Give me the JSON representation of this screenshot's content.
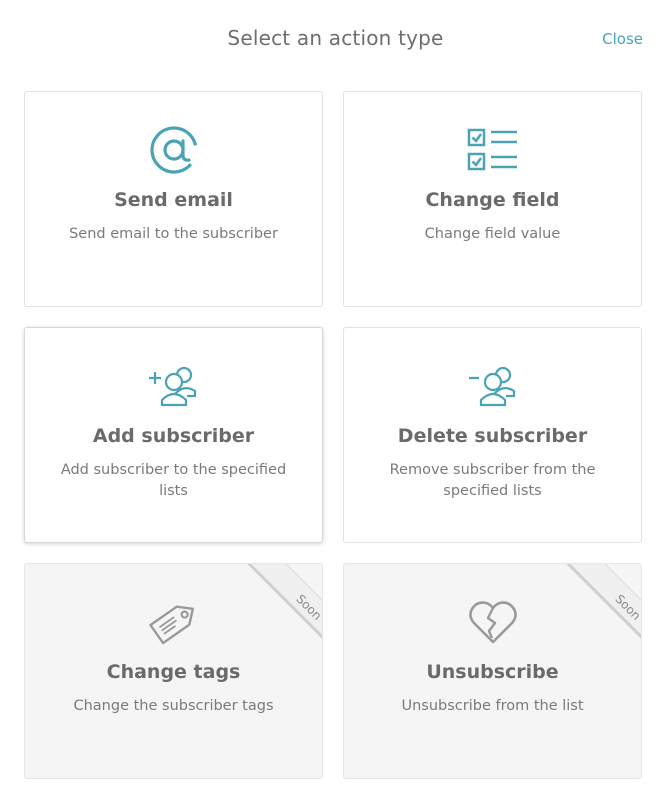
{
  "header": {
    "title": "Select an action type",
    "close_label": "Close"
  },
  "colors": {
    "accent": "#4aa3b5",
    "icon_gray": "#9a9a9a",
    "title_text": "#6a6a6a"
  },
  "cards": [
    {
      "name": "Send email",
      "description": "Send email to the subscriber",
      "icon": "at-icon",
      "soon": false
    },
    {
      "name": "Change field",
      "description": "Change field value",
      "icon": "checklist-icon",
      "soon": false
    },
    {
      "name": "Add subscriber",
      "description": "Add subscriber to the specified lists",
      "icon": "add-users-icon",
      "soon": false
    },
    {
      "name": "Delete subscriber",
      "description": "Remove subscriber from the specified lists",
      "icon": "remove-users-icon",
      "soon": false
    },
    {
      "name": "Change tags",
      "description": "Change the subscriber tags",
      "icon": "tag-icon",
      "soon": true,
      "badge": "Soon"
    },
    {
      "name": "Unsubscribe",
      "description": "Unsubscribe from the list",
      "icon": "broken-heart-icon",
      "soon": true,
      "badge": "Soon"
    }
  ]
}
